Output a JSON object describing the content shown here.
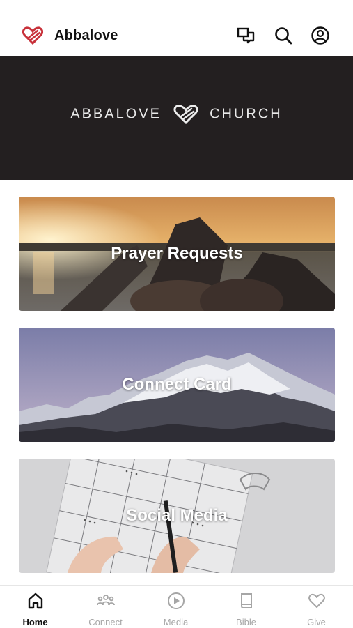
{
  "app": {
    "title": "Abbalove",
    "accent": "#c8313a"
  },
  "header": {
    "icons": [
      "chat-bubbles-icon",
      "search-icon",
      "profile-icon"
    ]
  },
  "banner": {
    "left_word": "ABBALOVE",
    "right_word": "CHURCH",
    "background": "#231f20"
  },
  "cards": [
    {
      "label": "Prayer Requests"
    },
    {
      "label": "Connect Card"
    },
    {
      "label": "Social Media"
    }
  ],
  "tabs": [
    {
      "label": "Home",
      "icon": "home-icon",
      "active": true
    },
    {
      "label": "Connect",
      "icon": "group-icon",
      "active": false
    },
    {
      "label": "Media",
      "icon": "play-circle-icon",
      "active": false
    },
    {
      "label": "Bible",
      "icon": "book-icon",
      "active": false
    },
    {
      "label": "Give",
      "icon": "heart-icon",
      "active": false
    }
  ]
}
